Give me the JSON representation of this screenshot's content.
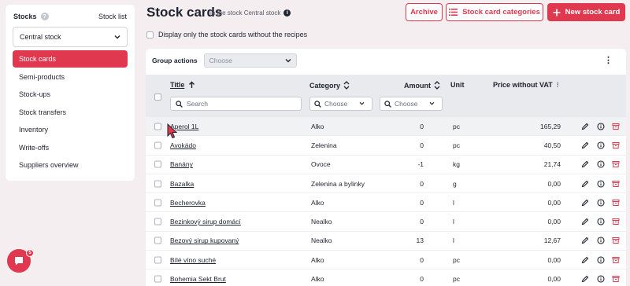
{
  "sidebar": {
    "title": "Stocks",
    "help": "?",
    "stock_list_link": "Stock list",
    "stock_select": "Central stock",
    "items": [
      {
        "label": "Stock cards",
        "active": true
      },
      {
        "label": "Semi-products"
      },
      {
        "label": "Stock-ups"
      },
      {
        "label": "Stock transfers"
      },
      {
        "label": "Inventory"
      },
      {
        "label": "Write-offs"
      },
      {
        "label": "Suppliers overview"
      }
    ]
  },
  "header": {
    "title": "Stock cards",
    "subtitle": "in the stock Central stock",
    "info": "i",
    "archive_btn": "Archive",
    "categories_btn": "Stock card categories",
    "new_btn": "New stock card"
  },
  "filter": {
    "label": "Display only the stock cards without the recipes"
  },
  "group_actions": {
    "label": "Group actions",
    "placeholder": "Choose"
  },
  "table": {
    "columns": {
      "title": "Title",
      "category": "Category",
      "amount": "Amount",
      "unit": "Unit",
      "price": "Price without VAT"
    },
    "search_placeholder": "Search",
    "category_filter": "Choose",
    "amount_filter": "Choose",
    "rows": [
      {
        "title": "Aperol 1L",
        "category": "Alko",
        "amount": "0",
        "unit": "pc",
        "price": "165,29"
      },
      {
        "title": "Avokádo",
        "category": "Zelenina",
        "amount": "0",
        "unit": "pc",
        "price": "40,50"
      },
      {
        "title": "Banány",
        "category": "Ovoce",
        "amount": "-1",
        "unit": "kg",
        "price": "21,74"
      },
      {
        "title": "Bazalka",
        "category": "Zelenina a bylinky",
        "amount": "0",
        "unit": "g",
        "price": "0,00"
      },
      {
        "title": "Becherovka",
        "category": "Alko",
        "amount": "0",
        "unit": "l",
        "price": "0,00"
      },
      {
        "title": "Bezinkový sirup domácí",
        "category": "Nealko",
        "amount": "0",
        "unit": "l",
        "price": "0,00"
      },
      {
        "title": "Bezový sirup kupovaný",
        "category": "Nealko",
        "amount": "13",
        "unit": "l",
        "price": "12,67"
      },
      {
        "title": "Bílé víno suché",
        "category": "Alko",
        "amount": "0",
        "unit": "pc",
        "price": "0,00"
      },
      {
        "title": "Bohemia Sekt Brut",
        "category": "Alko",
        "amount": "0",
        "unit": "pc",
        "price": "0,00"
      }
    ]
  },
  "chat": {
    "badge": "5"
  },
  "colors": {
    "accent": "#e0384e",
    "header_bg": "#e8eaed",
    "page_bg": "#f5eef0"
  }
}
